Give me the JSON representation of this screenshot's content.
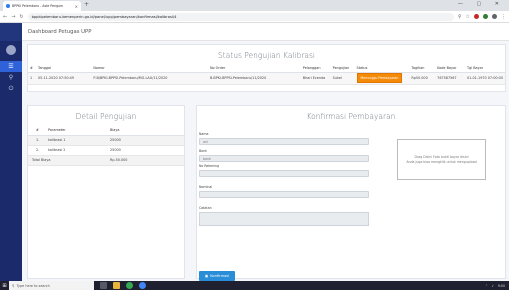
{
  "browser": {
    "tab_title": "BPPKI Pelembaru - Aste Pengum",
    "new_tab": "+",
    "window_controls": "— ▢ ✕",
    "url": "bppkipelembaru.kemenperin.go.id/panel/upp/pembayaran/konfirmasi/kalibrasi/4"
  },
  "app": {
    "topbar_title": "Dashboard Petugas UPP"
  },
  "status_card": {
    "title": "Status Pengujian Kalibrasi",
    "headers": [
      "#",
      "Tanggal",
      "Nomor",
      "No Order",
      "Pelanggan",
      "Pengujian",
      "Status",
      "Tagihan",
      "Kode Bayar",
      "Tgl Bayar"
    ],
    "row": {
      "num": "1",
      "tanggal": "05-11-2020 07:50:49",
      "nomor": "P-B/BPKI-BPPSI-Pelembaru/MG-LAU/11/2020",
      "no_order": "B-BPKI-BPPSI-Pelembaru/11/2020",
      "pelanggan": "Bhari Ecenda",
      "pengujian": "Sukel",
      "status": "Menunggu Pembayaran",
      "tagihan": "Rp50.000",
      "kode_bayar": "767587567",
      "tgl_bayar": "01-01-1970 07:00:00"
    }
  },
  "detail_card": {
    "title": "Detail Pengujian",
    "headers": [
      "#",
      "Parameter",
      "Biaya"
    ],
    "rows": [
      {
        "num": "1.",
        "parameter": "kalibrasi 1",
        "biaya": "25000"
      },
      {
        "num": "2.",
        "parameter": "kalibrasi 2",
        "biaya": "25000"
      }
    ],
    "total_label": "Total Biaya",
    "total_value": "Rp.50.000"
  },
  "confirm_card": {
    "title": "Konfirmasi Pembayaran",
    "fields": {
      "nama_label": "Nama",
      "nama_value": "ani",
      "bank_label": "Bank",
      "bank_value": "bank",
      "rekening_label": "No Rekening",
      "rekening_value": "",
      "nominal_label": "Nominal",
      "nominal_value": "",
      "catatan_label": "Catatan",
      "catatan_value": ""
    },
    "upload_line1": "Drag Disini Foto bukti bayar disini",
    "upload_line2": "Anda juga bisa mengklik untuk mengupload",
    "submit_label": "Konfirmasi"
  },
  "taskbar": {
    "search_placeholder": "Type here to search",
    "clock": "9:00"
  },
  "colors": {
    "sidebar": "#1b2a6b",
    "sidebar_active": "#2f62d8",
    "status_badge": "#f58a07",
    "button": "#2a8dd8"
  }
}
